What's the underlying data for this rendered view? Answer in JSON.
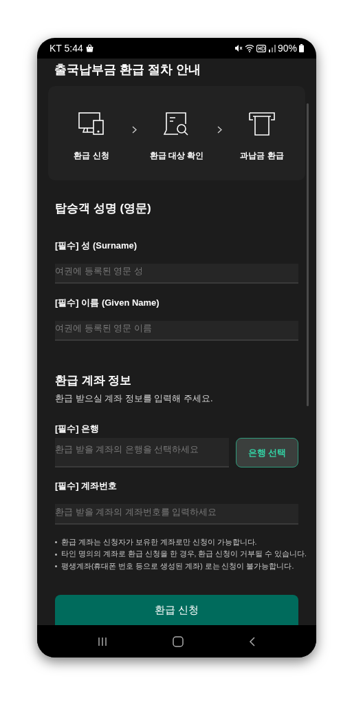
{
  "status_bar": {
    "time": "KT 5:44",
    "battery": "90%"
  },
  "title": "출국납부금 환급 절차 안내",
  "steps": [
    {
      "kind": "apply",
      "label": "환급 신청"
    },
    {
      "kind": "check",
      "label": "환급 대상 확인"
    },
    {
      "kind": "refund",
      "label": "과납금 환급"
    }
  ],
  "name_section": {
    "title": "탑승객 성명 (영문)",
    "fields": [
      {
        "label": "[필수] 성 (Surname)",
        "placeholder": "여권에 등록된 영문 성"
      },
      {
        "label": "[필수] 이름 (Given Name)",
        "placeholder": "여권에 등록된 영문 이름"
      }
    ]
  },
  "account_section": {
    "title": "환급 계좌 정보",
    "subtitle": "환급 받으실 계좌 정보를 입력해 주세요.",
    "bank": {
      "label": "[필수] 은행",
      "placeholder": "환급 받을 계좌의 은행을 선택하세요",
      "button": "은행 선택"
    },
    "account": {
      "label": "[필수] 계좌번호",
      "placeholder": "환급 받을 계좌의 계좌번호를 입력하세요"
    },
    "notes": [
      "환급 계좌는 신청자가 보유한 계좌로만 신청이 가능합니다.",
      "타인 명의의 계좌로 환급 신청을 한 경우, 환급 신청이 거부될 수 있습니다.",
      "평생계좌(휴대폰 번호 등으로 생성된 계좌) 로는 신청이 불가능합니다."
    ]
  },
  "submit": "환급 신청"
}
